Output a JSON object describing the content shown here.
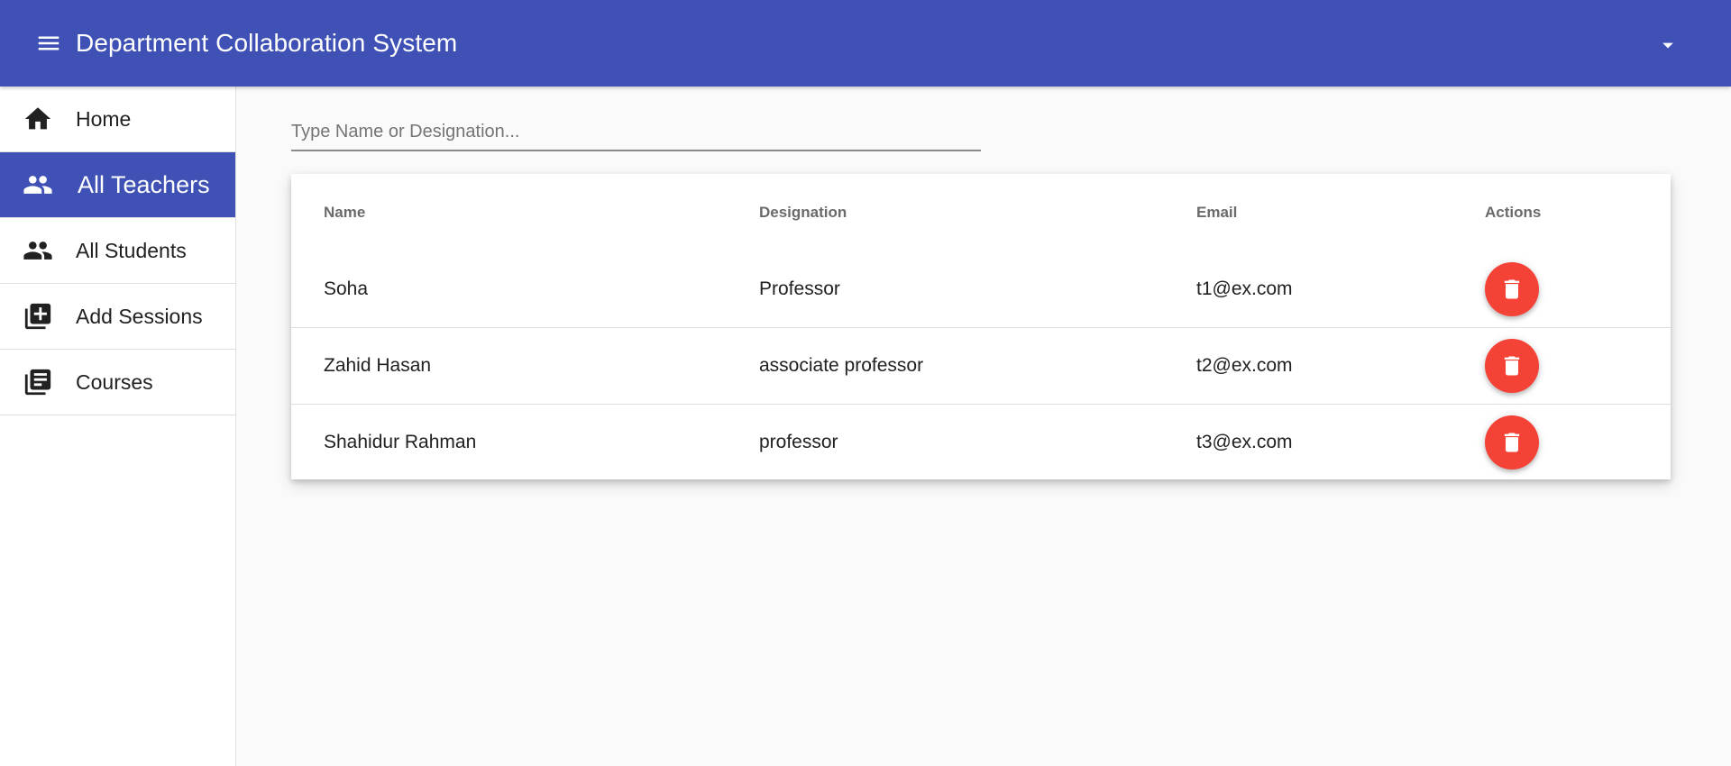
{
  "appbar": {
    "title": "Department Collaboration System",
    "menu_icon": "menu-icon",
    "account_icon": "arrow-drop-down-icon"
  },
  "sidebar": {
    "items": [
      {
        "label": "Home",
        "icon": "home-icon",
        "active": false
      },
      {
        "label": "All Teachers",
        "icon": "people-icon",
        "active": true
      },
      {
        "label": "All Students",
        "icon": "people-icon",
        "active": false
      },
      {
        "label": "Add Sessions",
        "icon": "library-add-icon",
        "active": false
      },
      {
        "label": "Courses",
        "icon": "library-books-icon",
        "active": false
      }
    ]
  },
  "search": {
    "placeholder": "Type Name or Designation...",
    "value": ""
  },
  "table": {
    "columns": [
      "Name",
      "Designation",
      "Email",
      "Actions"
    ],
    "rows": [
      {
        "name": "Soha",
        "designation": "Professor",
        "email": "t1@ex.com"
      },
      {
        "name": "Zahid Hasan",
        "designation": "associate professor",
        "email": "t2@ex.com"
      },
      {
        "name": "Shahidur Rahman",
        "designation": "professor",
        "email": "t3@ex.com"
      }
    ]
  },
  "colors": {
    "primary": "#3f51b5",
    "delete": "#f44336",
    "background": "#fafafa"
  }
}
